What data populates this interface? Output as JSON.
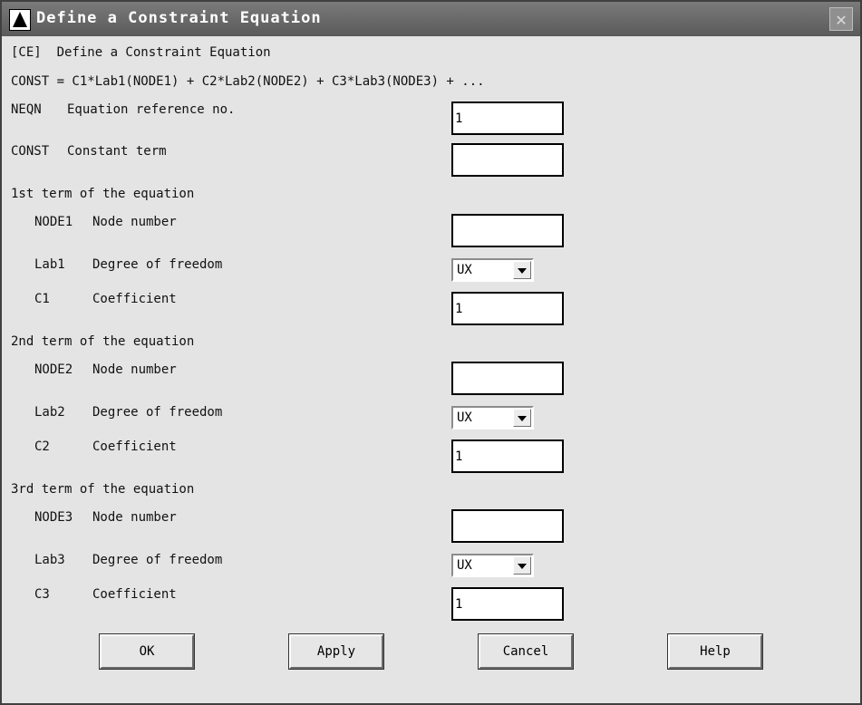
{
  "window": {
    "title": "Define a Constraint Equation"
  },
  "header": {
    "line1": "[CE]  Define a Constraint Equation",
    "line2": "CONST = C1*Lab1(NODE1) + C2*Lab2(NODE2) + C3*Lab3(NODE3) + ..."
  },
  "neqn": {
    "key": "NEQN",
    "label": "Equation reference no.",
    "value": "1"
  },
  "const": {
    "key": "CONST",
    "label": "Constant term",
    "value": ""
  },
  "terms": [
    {
      "heading": "1st term of the equation",
      "node": {
        "key": "NODE1",
        "label": "Node number",
        "value": ""
      },
      "lab": {
        "key": "Lab1",
        "label": "Degree of freedom",
        "value": "UX"
      },
      "coef": {
        "key": "C1",
        "label": "Coefficient",
        "value": "1"
      }
    },
    {
      "heading": "2nd term of the equation",
      "node": {
        "key": "NODE2",
        "label": "Node number",
        "value": ""
      },
      "lab": {
        "key": "Lab2",
        "label": "Degree of freedom",
        "value": "UX"
      },
      "coef": {
        "key": "C2",
        "label": "Coefficient",
        "value": "1"
      }
    },
    {
      "heading": "3rd term of the equation",
      "node": {
        "key": "NODE3",
        "label": "Node number",
        "value": ""
      },
      "lab": {
        "key": "Lab3",
        "label": "Degree of freedom",
        "value": "UX"
      },
      "coef": {
        "key": "C3",
        "label": "Coefficient",
        "value": "1"
      }
    }
  ],
  "buttons": {
    "ok": "OK",
    "apply": "Apply",
    "cancel": "Cancel",
    "help": "Help"
  },
  "icons": {
    "close": "close-icon",
    "logo": "ansys-logo-icon"
  }
}
